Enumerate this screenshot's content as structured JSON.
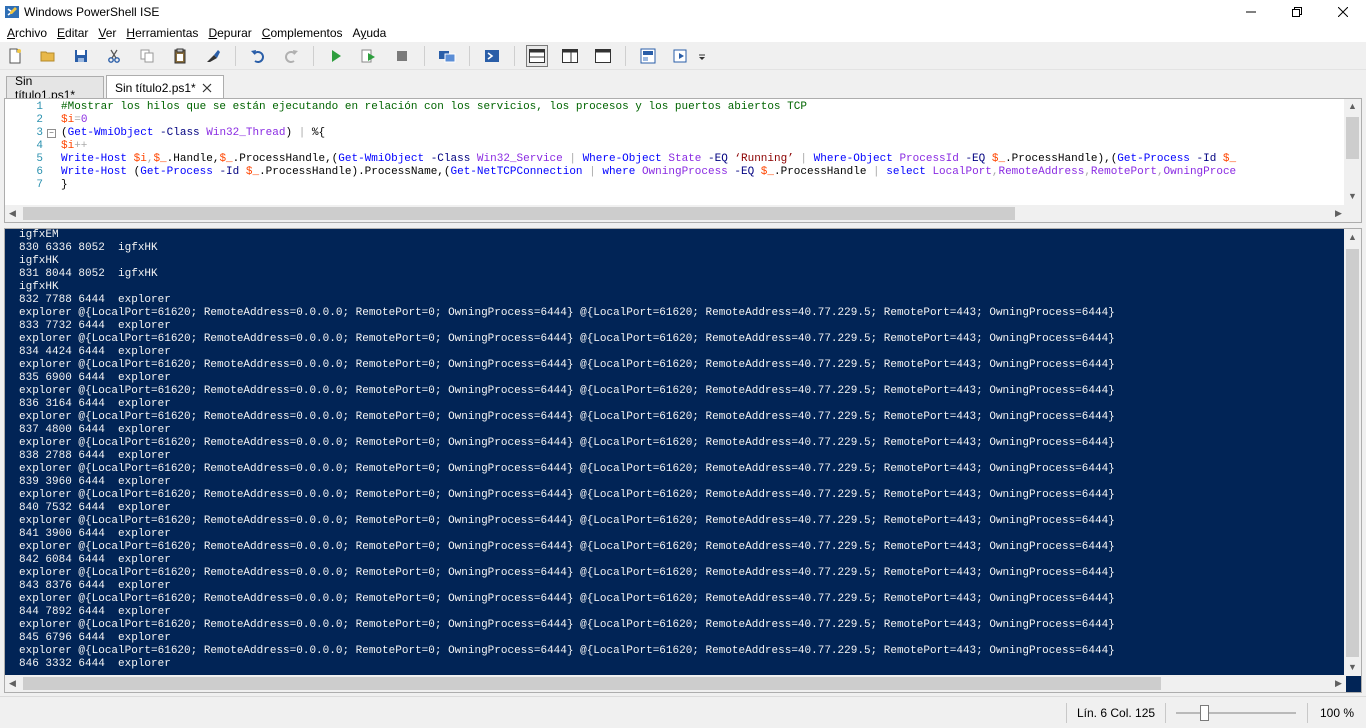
{
  "window": {
    "title": "Windows PowerShell ISE"
  },
  "menu": [
    {
      "accel": "A",
      "rest": "rchivo"
    },
    {
      "accel": "E",
      "rest": "ditar"
    },
    {
      "accel": "V",
      "rest": "er"
    },
    {
      "accel": "H",
      "rest": "erramientas"
    },
    {
      "accel": "D",
      "rest": "epurar"
    },
    {
      "accel": "C",
      "rest": "omplementos"
    },
    {
      "accel": "y",
      "pre": "A",
      "rest": "uda"
    }
  ],
  "toolbar": {
    "icons": [
      "new-file-icon",
      "open-folder-icon",
      "save-icon",
      "cut-icon",
      "copy-icon",
      "paste-icon",
      "clear-console-icon",
      "undo-icon",
      "redo-icon",
      "run-script-icon",
      "run-selection-icon",
      "stop-icon",
      "new-remote-tab-icon",
      "start-powershell-icon",
      "show-script-pane-top-icon",
      "show-script-pane-right-icon",
      "show-script-pane-maximized-icon",
      "show-command-window-icon",
      "show-command-addon-icon",
      "toolbar-overflow-icon"
    ]
  },
  "tabs": [
    {
      "label": "Sin título1.ps1*",
      "active": false
    },
    {
      "label": "Sin título2.ps1*",
      "active": true
    }
  ],
  "editor": {
    "line_numbers": [
      "1",
      "2",
      "3",
      "4",
      "5",
      "6",
      "7"
    ],
    "line1": "#Mostrar los hilos que se están ejecutando en relación con los servicios, los procesos y los puertos abiertos TCP",
    "line2": {
      "var": "$i",
      "op": "=",
      "num": "0"
    },
    "line3": {
      "p1": "(",
      "cmd": "Get-WmiObject",
      "param": " -Class",
      "type": " Win32_Thread",
      "p2": ") ",
      "pipe": "|",
      "rest": " %{"
    },
    "line4": {
      "var": "$i",
      "op": "++"
    },
    "line5": {
      "a": "Write-Host",
      "b": " $i",
      "c": ",",
      "d": "$_",
      "e": ".Handle,",
      "f": "$_",
      "g": ".ProcessHandle,(",
      "h": "Get-WmiObject",
      "i": " -Class",
      "j": " Win32_Service",
      "k": " | ",
      "l": "Where-Object",
      "m": " State",
      "n": " -EQ",
      "o": " ‘Running’",
      "p": " | ",
      "q": "Where-Object",
      "r": " ProcessId",
      "s": " -EQ",
      "t": " $_",
      "u": ".ProcessHandle),(",
      "v": "Get-Process",
      "w": " -Id",
      "x": " $_"
    },
    "line6": {
      "a": "Write-Host",
      "b": " (",
      "c": "Get-Process",
      "d": " -Id",
      "e": " $_",
      "f": ".ProcessHandle).ProcessName,(",
      "g": "Get-NetTCPConnection",
      "h": " | ",
      "i": "where",
      "j": " OwningProcess",
      "k": " -EQ",
      "l": " $_",
      "m": ".ProcessHandle ",
      "n": "|",
      "o": " select",
      "p": " LocalPort",
      "q": ",",
      "r": "RemoteAddress",
      "s": ",",
      "t": "RemotePort",
      "u": ",",
      "v": "OwningProce"
    },
    "line7": "}"
  },
  "console": {
    "lines": [
      "igfxEM",
      "830 6336 8052  igfxHK",
      "igfxHK",
      "831 8044 8052  igfxHK",
      "igfxHK",
      "832 7788 6444  explorer",
      "explorer @{LocalPort=61620; RemoteAddress=0.0.0.0; RemotePort=0; OwningProcess=6444} @{LocalPort=61620; RemoteAddress=40.77.229.5; RemotePort=443; OwningProcess=6444}",
      "833 7732 6444  explorer",
      "explorer @{LocalPort=61620; RemoteAddress=0.0.0.0; RemotePort=0; OwningProcess=6444} @{LocalPort=61620; RemoteAddress=40.77.229.5; RemotePort=443; OwningProcess=6444}",
      "834 4424 6444  explorer",
      "explorer @{LocalPort=61620; RemoteAddress=0.0.0.0; RemotePort=0; OwningProcess=6444} @{LocalPort=61620; RemoteAddress=40.77.229.5; RemotePort=443; OwningProcess=6444}",
      "835 6900 6444  explorer",
      "explorer @{LocalPort=61620; RemoteAddress=0.0.0.0; RemotePort=0; OwningProcess=6444} @{LocalPort=61620; RemoteAddress=40.77.229.5; RemotePort=443; OwningProcess=6444}",
      "836 3164 6444  explorer",
      "explorer @{LocalPort=61620; RemoteAddress=0.0.0.0; RemotePort=0; OwningProcess=6444} @{LocalPort=61620; RemoteAddress=40.77.229.5; RemotePort=443; OwningProcess=6444}",
      "837 4800 6444  explorer",
      "explorer @{LocalPort=61620; RemoteAddress=0.0.0.0; RemotePort=0; OwningProcess=6444} @{LocalPort=61620; RemoteAddress=40.77.229.5; RemotePort=443; OwningProcess=6444}",
      "838 2788 6444  explorer",
      "explorer @{LocalPort=61620; RemoteAddress=0.0.0.0; RemotePort=0; OwningProcess=6444} @{LocalPort=61620; RemoteAddress=40.77.229.5; RemotePort=443; OwningProcess=6444}",
      "839 3960 6444  explorer",
      "explorer @{LocalPort=61620; RemoteAddress=0.0.0.0; RemotePort=0; OwningProcess=6444} @{LocalPort=61620; RemoteAddress=40.77.229.5; RemotePort=443; OwningProcess=6444}",
      "840 7532 6444  explorer",
      "explorer @{LocalPort=61620; RemoteAddress=0.0.0.0; RemotePort=0; OwningProcess=6444} @{LocalPort=61620; RemoteAddress=40.77.229.5; RemotePort=443; OwningProcess=6444}",
      "841 3900 6444  explorer",
      "explorer @{LocalPort=61620; RemoteAddress=0.0.0.0; RemotePort=0; OwningProcess=6444} @{LocalPort=61620; RemoteAddress=40.77.229.5; RemotePort=443; OwningProcess=6444}",
      "842 6084 6444  explorer",
      "explorer @{LocalPort=61620; RemoteAddress=0.0.0.0; RemotePort=0; OwningProcess=6444} @{LocalPort=61620; RemoteAddress=40.77.229.5; RemotePort=443; OwningProcess=6444}",
      "843 8376 6444  explorer",
      "explorer @{LocalPort=61620; RemoteAddress=0.0.0.0; RemotePort=0; OwningProcess=6444} @{LocalPort=61620; RemoteAddress=40.77.229.5; RemotePort=443; OwningProcess=6444}",
      "844 7892 6444  explorer",
      "explorer @{LocalPort=61620; RemoteAddress=0.0.0.0; RemotePort=0; OwningProcess=6444} @{LocalPort=61620; RemoteAddress=40.77.229.5; RemotePort=443; OwningProcess=6444}",
      "845 6796 6444  explorer",
      "explorer @{LocalPort=61620; RemoteAddress=0.0.0.0; RemotePort=0; OwningProcess=6444} @{LocalPort=61620; RemoteAddress=40.77.229.5; RemotePort=443; OwningProcess=6444}",
      "846 3332 6444  explorer"
    ]
  },
  "status": {
    "position": "Lín. 6  Col. 125",
    "zoom": "100 %",
    "zoom_level_percent": 100
  },
  "colors": {
    "console_bg": "#012456",
    "accent": "#0078d7"
  }
}
